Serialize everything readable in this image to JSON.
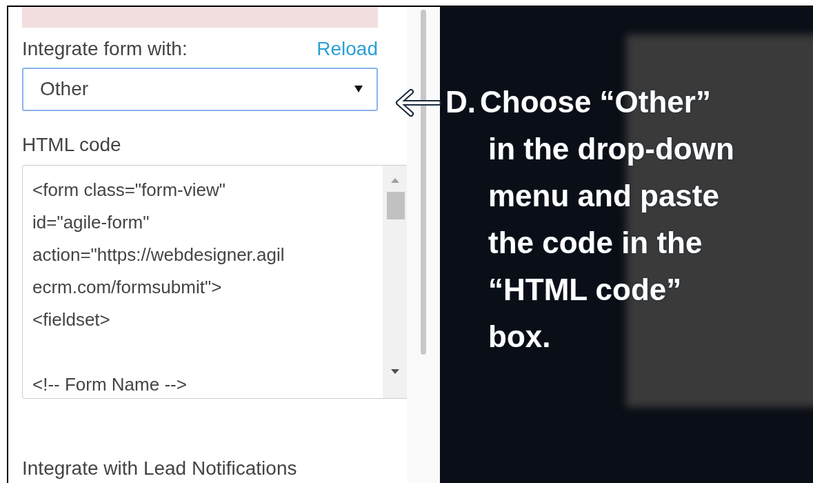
{
  "form": {
    "integrate_label": "Integrate form with:",
    "reload_link": "Reload",
    "select": {
      "value": "Other",
      "focused": true
    },
    "code_label": "HTML code",
    "code_blocks": [
      [
        "<form class=\"form-view\"",
        "id=\"agile-form\"",
        "action=\"https://webdesigner.agil",
        "ecrm.com/formsubmit\">",
        "<fieldset>"
      ],
      [
        "<!-- Form Name -->"
      ]
    ],
    "notifications_label": "Integrate with Lead Notifications"
  },
  "annotation": {
    "marker": "D.",
    "lines": [
      "Choose “Other”",
      "in the drop-down",
      "menu and paste",
      "the code in the",
      "“HTML code”",
      "box."
    ]
  }
}
